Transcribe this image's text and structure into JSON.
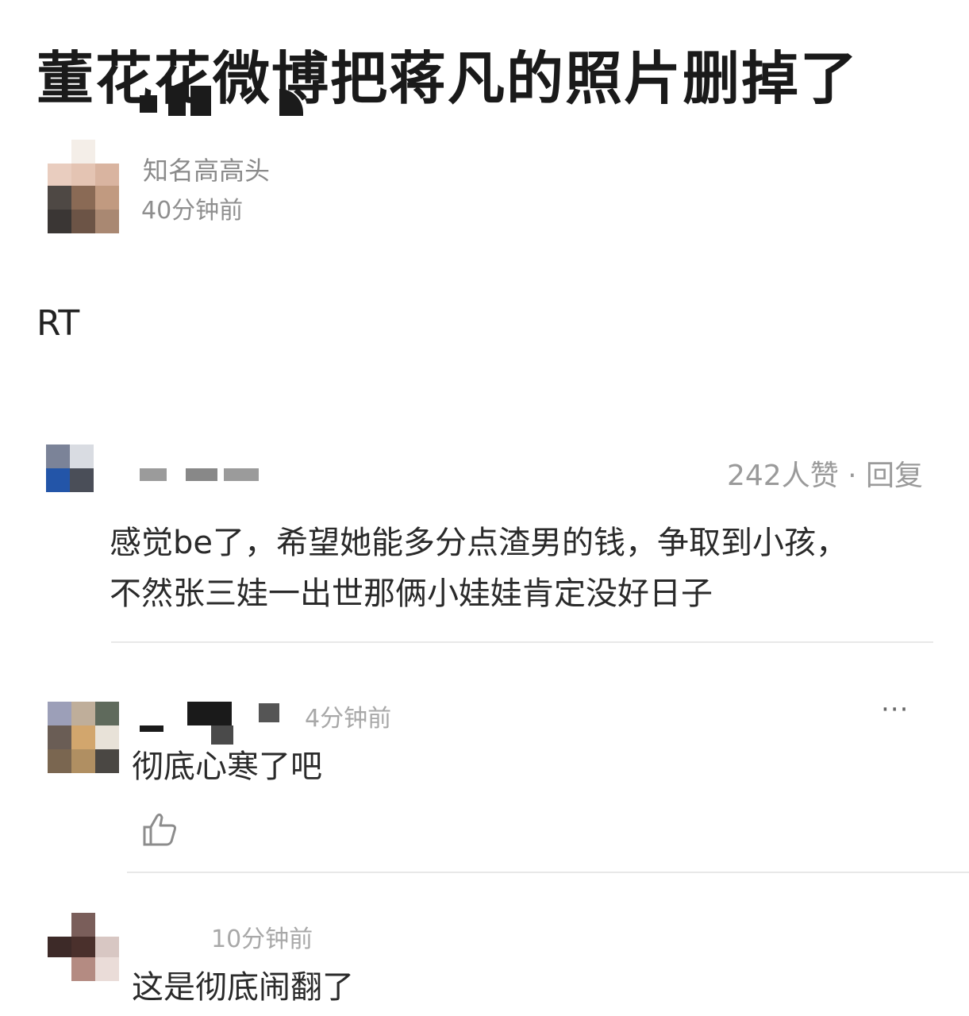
{
  "post": {
    "title": "董花花微博把蒋凡的照片删掉了",
    "username": "知名高高头",
    "time": "40分钟前",
    "body": "RT"
  },
  "comments": [
    {
      "meta": "242人赞 · 回复",
      "text_line1": "感觉be了，希望她能多分点渣男的钱，争取到小孩，",
      "text_line2": "不然张三娃一出世那俩小娃娃肯定没好日子"
    },
    {
      "time": "4分钟前",
      "more": "···",
      "text": "彻底心寒了吧",
      "like_icon": "thumbs-up-icon"
    },
    {
      "time": "10分钟前",
      "text": "这是彻底闹翻了"
    }
  ]
}
